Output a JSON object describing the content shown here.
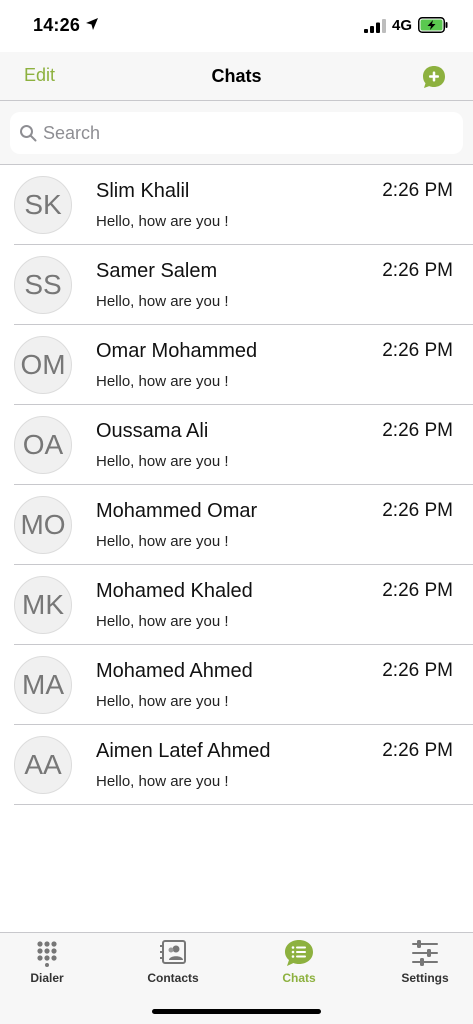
{
  "status_bar": {
    "time": "14:26",
    "network": "4G"
  },
  "nav": {
    "edit_label": "Edit",
    "title": "Chats"
  },
  "search": {
    "placeholder": "Search"
  },
  "chats": [
    {
      "initials": "SK",
      "name": "Slim Khalil",
      "time": "2:26 PM",
      "preview": "Hello, how are you !"
    },
    {
      "initials": "SS",
      "name": "Samer Salem",
      "time": "2:26 PM",
      "preview": "Hello, how are you !"
    },
    {
      "initials": "OM",
      "name": "Omar Mohammed",
      "time": "2:26 PM",
      "preview": "Hello, how are you !"
    },
    {
      "initials": "OA",
      "name": "Oussama Ali",
      "time": "2:26 PM",
      "preview": "Hello, how are you !"
    },
    {
      "initials": "MO",
      "name": "Mohammed Omar",
      "time": "2:26 PM",
      "preview": "Hello, how are you !"
    },
    {
      "initials": "MK",
      "name": "Mohamed Khaled",
      "time": "2:26 PM",
      "preview": "Hello, how are you !"
    },
    {
      "initials": "MA",
      "name": "Mohamed Ahmed",
      "time": "2:26 PM",
      "preview": "Hello, how are you !"
    },
    {
      "initials": "AA",
      "name": "Aimen Latef Ahmed",
      "time": "2:26 PM",
      "preview": "Hello, how are you !"
    }
  ],
  "tabs": [
    {
      "label": "Dialer",
      "icon": "dialpad-icon",
      "active": false
    },
    {
      "label": "Contacts",
      "icon": "contacts-icon",
      "active": false
    },
    {
      "label": "Chats",
      "icon": "chat-bubble-icon",
      "active": true
    },
    {
      "label": "Settings",
      "icon": "sliders-icon",
      "active": false
    }
  ],
  "colors": {
    "accent": "#8db13f",
    "separator": "#c8c8cc",
    "bar_background": "#f7f7f7"
  }
}
